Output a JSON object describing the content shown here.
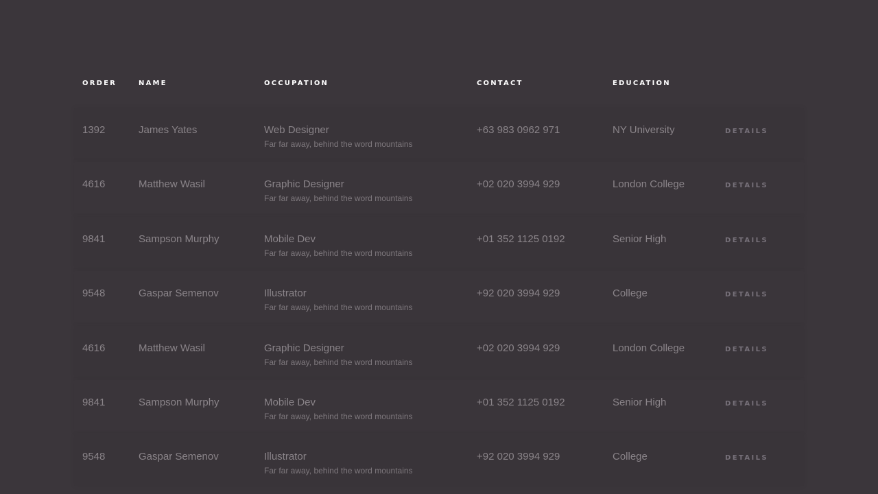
{
  "table": {
    "headers": {
      "order": "ORDER",
      "name": "NAME",
      "occupation": "OCCUPATION",
      "contact": "CONTACT",
      "education": "EDUCATION"
    },
    "rows": [
      {
        "order": "1392",
        "name": "James Yates",
        "occupation": "Web Designer",
        "occupation_sub": "Far far away, behind the word mountains",
        "contact": "+63 983 0962 971",
        "education": "NY University",
        "action": "DETAILS"
      },
      {
        "order": "4616",
        "name": "Matthew Wasil",
        "occupation": "Graphic Designer",
        "occupation_sub": "Far far away, behind the word mountains",
        "contact": "+02 020 3994 929",
        "education": "London College",
        "action": "DETAILS"
      },
      {
        "order": "9841",
        "name": "Sampson Murphy",
        "occupation": "Mobile Dev",
        "occupation_sub": "Far far away, behind the word mountains",
        "contact": "+01 352 1125 0192",
        "education": "Senior High",
        "action": "DETAILS"
      },
      {
        "order": "9548",
        "name": "Gaspar Semenov",
        "occupation": "Illustrator",
        "occupation_sub": "Far far away, behind the word mountains",
        "contact": "+92 020 3994 929",
        "education": "College",
        "action": "DETAILS"
      },
      {
        "order": "4616",
        "name": "Matthew Wasil",
        "occupation": "Graphic Designer",
        "occupation_sub": "Far far away, behind the word mountains",
        "contact": "+02 020 3994 929",
        "education": "London College",
        "action": "DETAILS"
      },
      {
        "order": "9841",
        "name": "Sampson Murphy",
        "occupation": "Mobile Dev",
        "occupation_sub": "Far far away, behind the word mountains",
        "contact": "+01 352 1125 0192",
        "education": "Senior High",
        "action": "DETAILS"
      },
      {
        "order": "9548",
        "name": "Gaspar Semenov",
        "occupation": "Illustrator",
        "occupation_sub": "Far far away, behind the word mountains",
        "contact": "+92 020 3994 929",
        "education": "College",
        "action": "DETAILS"
      }
    ]
  },
  "colors": {
    "background": "#3b363b",
    "header_text": "#ffffff",
    "body_text": "#8a8489",
    "action_text": "#77717a"
  }
}
